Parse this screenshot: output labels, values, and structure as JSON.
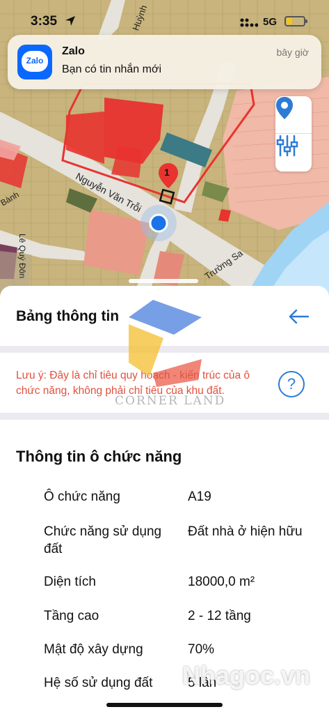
{
  "status_bar": {
    "time": "3:35",
    "network": "5G"
  },
  "notification": {
    "app_name": "Zalo",
    "app_icon_text": "Zalo",
    "time": "bây giờ",
    "message": "Bạn có tin nhắn mới"
  },
  "map": {
    "streets": [
      "Nguyễn Văn Trỗi",
      "Trường Sa",
      "Lê Quý Đôn",
      "Huỳnh",
      "Bành"
    ],
    "marker_label": "1"
  },
  "sheet": {
    "title": "Bảng thông tin",
    "note": "Lưu ý: Đây là chỉ tiêu quy hoạch - kiến trúc của ô chức năng, không phải chỉ tiêu của khu đất.",
    "section_title": "Thông tin ô chức năng",
    "rows": [
      {
        "label": "Ô chức năng",
        "value": "A19"
      },
      {
        "label": "Chức năng sử dụng đất",
        "value": "Đất nhà ở hiện hữu"
      },
      {
        "label": "Diện tích",
        "value": "18000,0 m²"
      },
      {
        "label": "Tầng cao",
        "value": "2 - 12 tầng"
      },
      {
        "label": "Mật độ xây dựng",
        "value": "70%"
      },
      {
        "label": "Hệ số sử dụng đất",
        "value": "5 lần"
      }
    ]
  },
  "watermarks": {
    "corner_land": "CORNER LAND",
    "nhagoc": "Nhagoc.vn"
  },
  "colors": {
    "accent_blue": "#2d7bd6",
    "warning_red": "#e0513e",
    "plot_red": "#e8332f",
    "zalo_blue": "#0a68ff"
  },
  "icons": [
    "navigation-arrow-icon",
    "signal-icon",
    "battery-icon",
    "map-pin-icon",
    "filter-sliders-icon",
    "back-arrow-icon",
    "help-icon",
    "location-dot-icon"
  ]
}
